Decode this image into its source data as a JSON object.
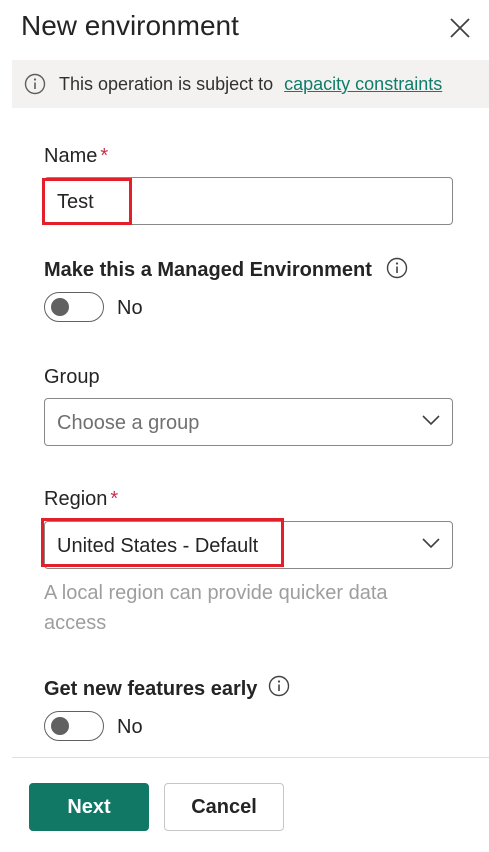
{
  "panel": {
    "title": "New environment"
  },
  "banner": {
    "text": "This operation is subject to",
    "link": "capacity constraints",
    "icon": "info-icon"
  },
  "name_field": {
    "label": "Name",
    "required_mark": "*",
    "value": "Test"
  },
  "managed_env": {
    "label": "Make this a Managed Environment",
    "toggle_state": "No",
    "on": false
  },
  "group_field": {
    "label": "Group",
    "placeholder": "Choose a group"
  },
  "region_field": {
    "label": "Region",
    "required_mark": "*",
    "value": "United States - Default",
    "helper": "A local region can provide quicker data access"
  },
  "early_features": {
    "label": "Get new features early",
    "toggle_state": "No",
    "on": false
  },
  "footer": {
    "next_label": "Next",
    "cancel_label": "Cancel"
  },
  "colors": {
    "primary": "#117865",
    "link": "#107c6b",
    "required": "#c4314b",
    "highlight": "#e3202a"
  }
}
